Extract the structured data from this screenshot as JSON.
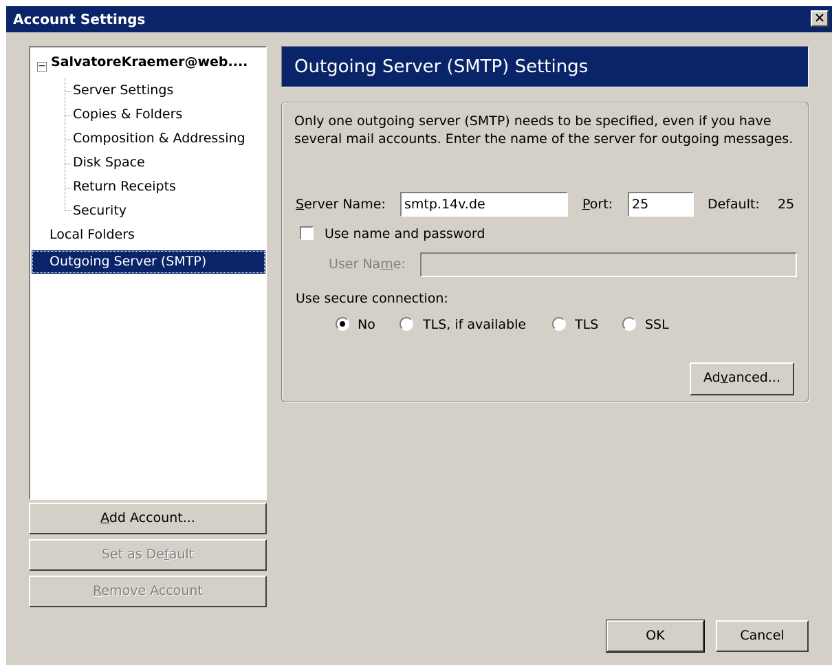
{
  "window": {
    "title": "Account Settings",
    "close_glyph": "✕"
  },
  "tree": {
    "root": {
      "label": "SalvatoreKraemer@web....",
      "expander": "−"
    },
    "children": [
      {
        "label": "Server Settings"
      },
      {
        "label": "Copies & Folders"
      },
      {
        "label": "Composition & Addressing"
      },
      {
        "label": "Disk Space"
      },
      {
        "label": "Return Receipts"
      },
      {
        "label": "Security"
      }
    ],
    "top_items": [
      {
        "label": "Local Folders"
      },
      {
        "label": "Outgoing Server (SMTP)",
        "selected": true
      }
    ]
  },
  "left_buttons": {
    "add_account": {
      "pre": "",
      "key": "A",
      "post": "dd Account..."
    },
    "set_default": {
      "pre": "Set as De",
      "key": "f",
      "post": "ault"
    },
    "remove_account": {
      "pre": "",
      "key": "R",
      "post": "emove Account"
    }
  },
  "panel": {
    "header": "Outgoing Server (SMTP) Settings",
    "description": "Only one outgoing server (SMTP) needs to be specified, even if you have several mail accounts. Enter the name of the server for outgoing messages.",
    "server_name": {
      "pre": "",
      "key": "S",
      "post": "erver Name:",
      "value": "smtp.14v.de"
    },
    "port": {
      "pre": "",
      "key": "P",
      "post": "ort:",
      "value": "25"
    },
    "default_port": {
      "label": "Default:",
      "value": "25"
    },
    "use_auth": {
      "label": "Use name and password",
      "checked": false
    },
    "user_name": {
      "pre": "User Na",
      "key": "m",
      "post": "e:",
      "value": ""
    },
    "secure_connection": {
      "label": "Use secure connection:",
      "options": [
        {
          "label": "No",
          "selected": true
        },
        {
          "label": "TLS, if available",
          "selected": false
        },
        {
          "label": "TLS",
          "selected": false
        },
        {
          "label": "SSL",
          "selected": false
        }
      ]
    },
    "advanced": {
      "pre": "Ad",
      "key": "v",
      "post": "anced..."
    }
  },
  "footer": {
    "ok": "OK",
    "cancel": "Cancel"
  },
  "colors": {
    "face": "#d4d0c8",
    "title_bar": "#0a246a",
    "selection": "#0a246a"
  }
}
